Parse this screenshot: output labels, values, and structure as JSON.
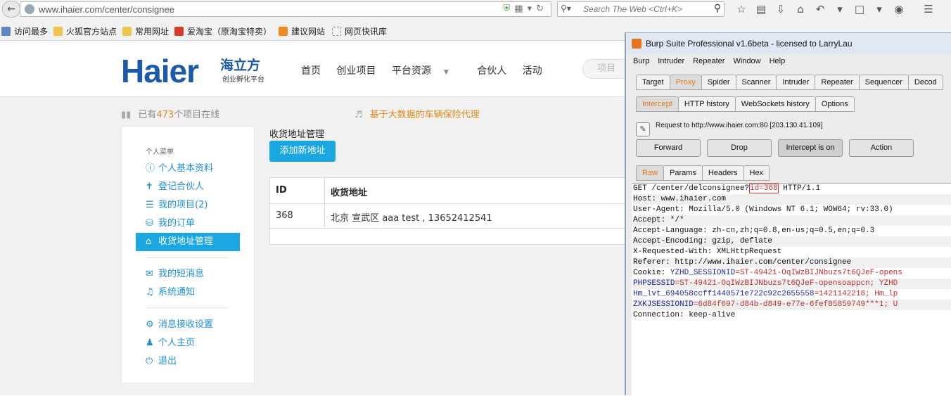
{
  "browser": {
    "url": "www.ihaier.com/center/consignee",
    "search_placeholder": "Search The Web <Ctrl+K>",
    "bookmarks": [
      "访问最多",
      "火狐官方站点",
      "常用网址",
      "爱淘宝（原淘宝特卖）",
      "建议网站",
      "网页快讯库"
    ]
  },
  "site": {
    "logo": "Haier",
    "logo_cn": "海立方",
    "logo_tagline": "创业孵化平台",
    "nav": [
      "首页",
      "创业项目",
      "平台资源",
      "合伙人",
      "活动"
    ],
    "search_placeholder": "项目",
    "stats_prefix": "已有",
    "stats_count": "473",
    "stats_suffix": "个项目在线",
    "ad_text": "基于大数据的车辆保险代理",
    "menu": {
      "title": "个人菜单",
      "items": [
        {
          "label": "个人基本资料",
          "icon": "info-icon"
        },
        {
          "label": "登记合伙人",
          "icon": "user-tie-icon"
        },
        {
          "label": "我的项目(2)",
          "icon": "list-icon"
        },
        {
          "label": "我的订单",
          "icon": "cart-icon"
        },
        {
          "label": "收货地址管理",
          "icon": "home-icon"
        },
        {
          "label": "我的短消息",
          "icon": "envelope-icon"
        },
        {
          "label": "系统通知",
          "icon": "bullhorn-icon"
        },
        {
          "label": "消息接收设置",
          "icon": "gear-icon"
        },
        {
          "label": "个人主页",
          "icon": "user-icon"
        },
        {
          "label": "退出",
          "icon": "power-icon"
        }
      ]
    },
    "content": {
      "title": "收货地址管理",
      "add_button": "添加新地址",
      "columns": [
        "ID",
        "收货地址"
      ],
      "rows": [
        {
          "id": "368",
          "address": "北京 宣武区 aaa  test , 13652412541"
        }
      ]
    }
  },
  "burp": {
    "title": "Burp Suite Professional v1.6beta - licensed to LarryLau",
    "menu": [
      "Burp",
      "Intruder",
      "Repeater",
      "Window",
      "Help"
    ],
    "main_tabs": [
      "Target",
      "Proxy",
      "Spider",
      "Scanner",
      "Intruder",
      "Repeater",
      "Sequencer",
      "Decod"
    ],
    "proxy_tabs": [
      "Intercept",
      "HTTP history",
      "WebSockets history",
      "Options"
    ],
    "request_info": "Request to http://www.ihaier.com:80  [203.130.41.109]",
    "buttons": [
      "Forward",
      "Drop",
      "Intercept is on",
      "Action"
    ],
    "view_tabs": [
      "Raw",
      "Params",
      "Headers",
      "Hex"
    ],
    "raw": {
      "line1_pre": "GET /center/delconsignee?",
      "line1_id": "id=368",
      "line1_post": " HTTP/1.1",
      "host": "Host: www.ihaier.com",
      "ua": "User-Agent: Mozilla/5.0 (Windows NT 6.1; WOW64; rv:33.0)",
      "accept": "Accept: */*",
      "lang": "Accept-Language: zh-cn,zh;q=0.8,en-us;q=0.5,en;q=0.3",
      "enc": "Accept-Encoding: gzip, deflate",
      "xrw": "X-Requested-With: XMLHttpRequest",
      "ref": "Referer: http://www.ihaier.com/center/consignee",
      "cookie_label": "Cookie: ",
      "cookie1_name": "YZHD_SESSIONID",
      "cookie1_val": "=ST-49421-OqIWzBIJNbuzs7t6QJeF-opens",
      "cookie2_name": "PHPSESSID",
      "cookie2_val": "=ST-49421-OqIWzBIJNbuzs7t6QJeF-opensoappcn; YZHD",
      "cookie3_name": "Hm_lvt_694058ccff1440571e722c92c2655558",
      "cookie3_val": "=1421142218; Hm_lp",
      "cookie4_name": "ZXKJSESSIONID",
      "cookie4_val": "=6d84f697-d84b-d849-e77e-6fef85859749***1; U",
      "conn": "Connection: keep-alive"
    }
  }
}
